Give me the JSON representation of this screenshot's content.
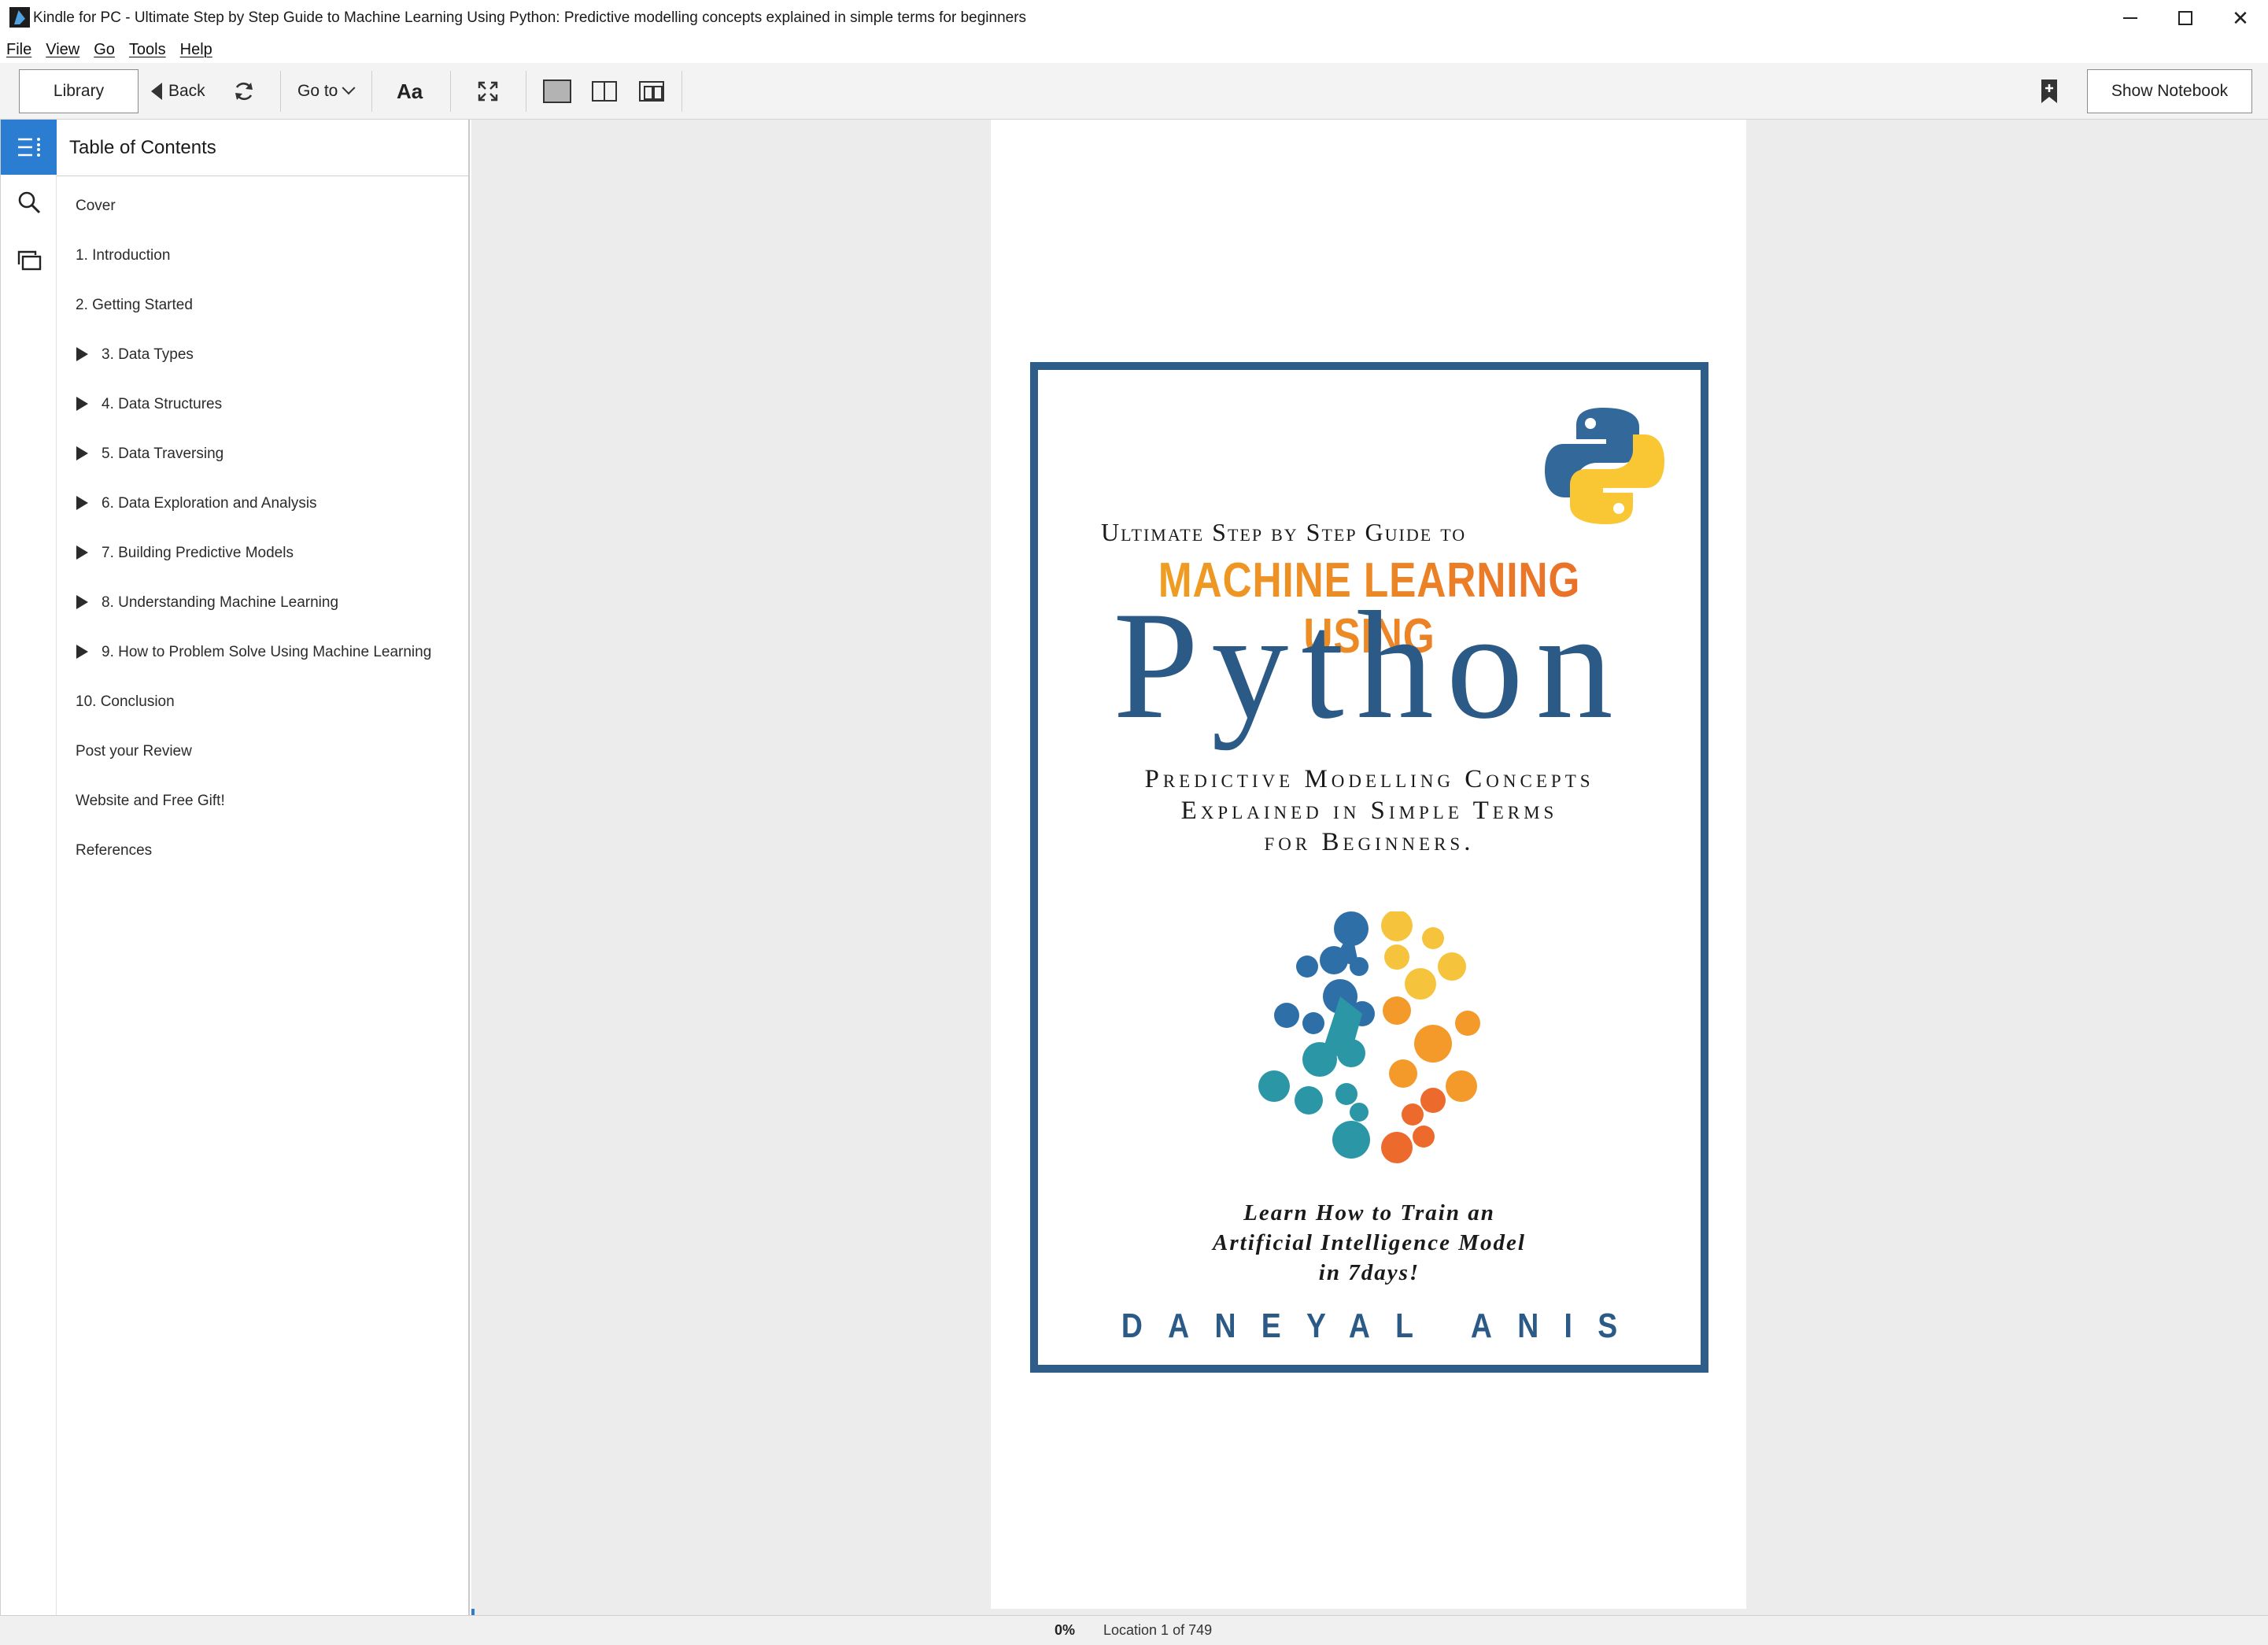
{
  "window": {
    "title": "Kindle for PC - Ultimate Step by Step Guide to Machine Learning Using Python: Predictive modelling concepts explained in simple terms for beginners",
    "controls": [
      "minimize",
      "maximize",
      "close"
    ]
  },
  "menu": {
    "items": [
      "File",
      "View",
      "Go",
      "Tools",
      "Help"
    ]
  },
  "toolbar": {
    "library_label": "Library",
    "back_label": "Back",
    "goto_label": "Go to",
    "font_label": "Aa",
    "show_notebook_label": "Show Notebook",
    "icons": [
      "refresh-icon",
      "fullscreen-icon",
      "single-page-view-icon",
      "two-page-view-icon",
      "grid-view-icon",
      "bookmark-add-icon"
    ]
  },
  "rail": {
    "icons": [
      "toc-list-icon",
      "search-icon",
      "flashcards-icon"
    ],
    "active": "toc-list-icon",
    "accent": "#2a7dd1"
  },
  "toc": {
    "header": "Table of Contents",
    "items": [
      {
        "label": "Cover",
        "expandable": false
      },
      {
        "label": "1. Introduction",
        "expandable": false
      },
      {
        "label": "2. Getting Started",
        "expandable": false
      },
      {
        "label": "3. Data Types",
        "expandable": true
      },
      {
        "label": "4. Data Structures",
        "expandable": true
      },
      {
        "label": "5. Data Traversing",
        "expandable": true
      },
      {
        "label": "6. Data Exploration and Analysis",
        "expandable": true
      },
      {
        "label": "7. Building Predictive Models",
        "expandable": true
      },
      {
        "label": "8. Understanding Machine Learning",
        "expandable": true
      },
      {
        "label": "9. How to Problem Solve Using Machine Learning",
        "expandable": true
      },
      {
        "label": "10. Conclusion",
        "expandable": false
      },
      {
        "label": "Post your Review",
        "expandable": false
      },
      {
        "label": "Website and Free Gift!",
        "expandable": false
      },
      {
        "label": "References",
        "expandable": false
      }
    ]
  },
  "cover": {
    "subtitle_top": "Ultimate Step by Step Guide to",
    "ml_line": "MACHINE LEARNING USING",
    "python": "Python",
    "desc_lines": [
      "Predictive Modelling Concepts",
      "Explained in Simple Terms",
      "for Beginners."
    ],
    "tagline_lines": [
      "Learn How to Train an",
      "Artificial Intelligence Model",
      "in 7days!"
    ],
    "author": "DANEYAL ANIS",
    "colors": {
      "border": "#2f5d8a",
      "orange": "#f0961e",
      "blue": "#2b5a87"
    }
  },
  "status": {
    "percent": "0%",
    "location": "Location 1 of 749"
  }
}
